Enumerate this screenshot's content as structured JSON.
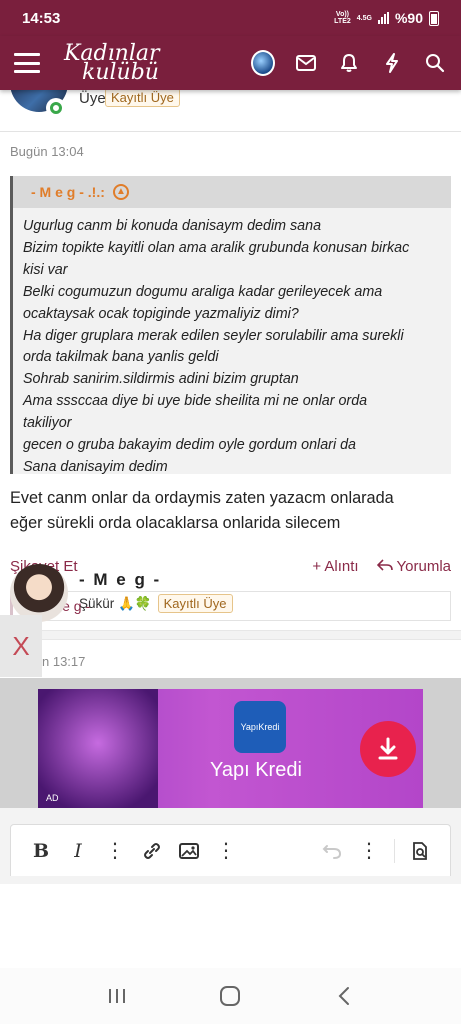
{
  "status_bar": {
    "time": "14:53",
    "network_top": "Vo))",
    "network_mid": "LTE2",
    "network_type": "4.5G",
    "battery": "%90"
  },
  "header": {
    "logo_line1": "Kadınlar",
    "logo_line2": "kulübü",
    "brand_color": "#7a1f3d",
    "icons": [
      "menu-icon",
      "avatar",
      "mail-icon",
      "bell-icon",
      "bolt-icon",
      "search-icon"
    ]
  },
  "post1": {
    "user_title": "Üye",
    "badge": "Kayıtlı Üye",
    "date": "Bugün 13:04",
    "quote": {
      "author": "- M e g - .!.:",
      "lines": [
        "Ugurlug canm bi konuda danisaym dedim sana",
        "Bizim topikte kayitli olan ama aralik grubunda konusan birkac",
        "kisi var",
        "Belki cogumuzun dogumu araliga kadar gerileyecek ama",
        "ocaktaysak ocak topiginde yazmaliyiz dimi?",
        "Ha diger gruplara merak edilen seyler sorulabilir ama surekli",
        "orda takilmak bana yanlis geldi",
        "Sohrab sanirim.sildirmis adini bizim gruptan",
        "Ama sssccaa diye bi uye bide sheilita mi ne onlar orda",
        "takiliyor",
        "gecen o gruba bakayim dedim oyle gordum onlari da",
        "Sana danisayim dedim"
      ]
    },
    "reply_line1": "Evet canm onlar da ordaymis zaten yazacm onlarada",
    "reply_line2": "eğer sürekli orda olacaklarsa onlarida silecem",
    "actions": {
      "report": "Şikayet Et",
      "quote": "+ Alıntı",
      "comment": "Yorumla"
    },
    "reaction_user": "- M e g -"
  },
  "post2": {
    "name": "- M e g -",
    "status": "Şükür 🙏🍀",
    "badge": "Kayıtlı Üye",
    "date": "n 13:17"
  },
  "overlay": {
    "close_label": "X"
  },
  "ad": {
    "brand": "Yapı Kredi",
    "logo_text": "YapıKredi",
    "tag": "AD"
  },
  "editor_toolbar": {
    "bold": "B",
    "italic": "I"
  }
}
